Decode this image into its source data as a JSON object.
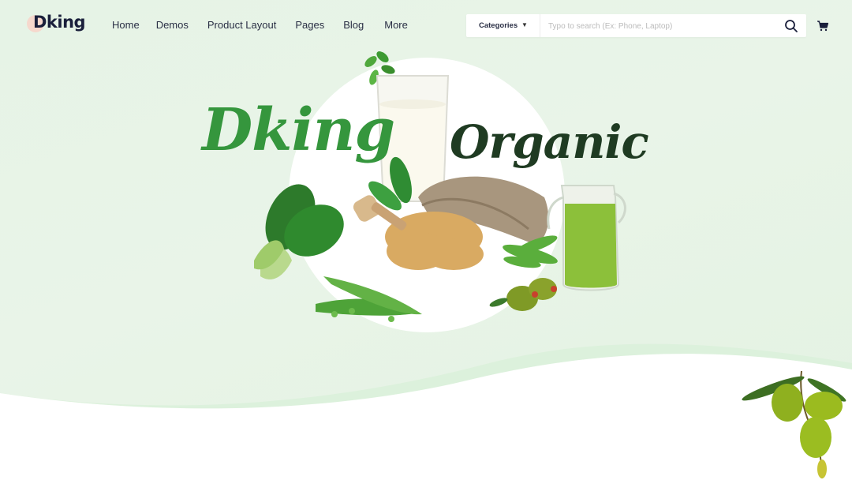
{
  "header": {
    "logo_text": "Dking",
    "nav": [
      {
        "label": "Home"
      },
      {
        "label": "Demos"
      },
      {
        "label": "Product Layout"
      },
      {
        "label": "Pages"
      },
      {
        "label": "Blog"
      },
      {
        "label": "More"
      }
    ],
    "search": {
      "category_label": "Categories",
      "placeholder": "Typo to search (Ex: Phone, Laptop)",
      "search_icon": "search-icon"
    },
    "cart_icon": "cart-icon"
  },
  "hero": {
    "title_word_1": "Dking",
    "title_word_2": "Organic"
  },
  "colors": {
    "background": "#e6f3e6",
    "accent_green": "#35963d",
    "dark_green": "#1f3b22",
    "nav_text": "#2a2f45"
  }
}
